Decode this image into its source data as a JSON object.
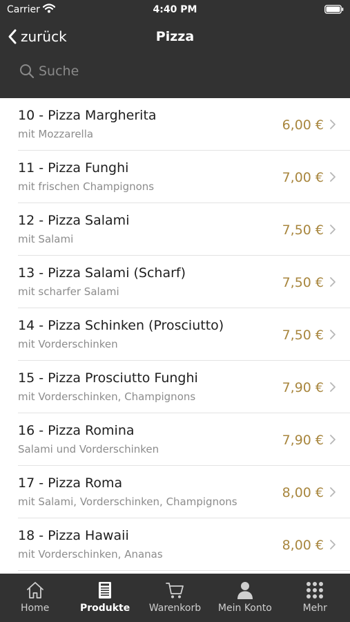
{
  "status_bar": {
    "carrier": "Carrier",
    "time": "4:40 PM"
  },
  "nav": {
    "back_label": "zurück",
    "title": "Pizza"
  },
  "search": {
    "placeholder": "Suche"
  },
  "colors": {
    "header_bg": "#323232",
    "price": "#a8863e",
    "subtitle": "#8c8c8c"
  },
  "products": [
    {
      "title": "10 - Pizza Margherita",
      "subtitle": "mit Mozzarella",
      "price": "6,00 €"
    },
    {
      "title": "11 - Pizza Funghi",
      "subtitle": "mit frischen Champignons",
      "price": "7,00 €"
    },
    {
      "title": "12 - Pizza Salami",
      "subtitle": "mit Salami",
      "price": "7,50 €"
    },
    {
      "title": "13 - Pizza Salami (Scharf)",
      "subtitle": "mit scharfer Salami",
      "price": "7,50 €"
    },
    {
      "title": "14 - Pizza Schinken (Prosciutto)",
      "subtitle": "mit Vorderschinken",
      "price": "7,50 €"
    },
    {
      "title": "15 - Pizza Prosciutto Funghi",
      "subtitle": "mit Vorderschinken, Champignons",
      "price": "7,90 €"
    },
    {
      "title": "16 - Pizza Romina",
      "subtitle": "Salami und Vorderschinken",
      "price": "7,90 €"
    },
    {
      "title": "17 - Pizza Roma",
      "subtitle": "mit Salami, Vorderschinken, Champignons",
      "price": "8,00 €"
    },
    {
      "title": "18 - Pizza Hawaii",
      "subtitle": "mit Vorderschinken, Ananas",
      "price": "8,00 €"
    }
  ],
  "tabbar": {
    "active": "Produkte",
    "tabs": [
      {
        "label": "Home",
        "icon": "home-icon"
      },
      {
        "label": "Produkte",
        "icon": "menu-card-icon"
      },
      {
        "label": "Warenkorb",
        "icon": "cart-icon"
      },
      {
        "label": "Mein Konto",
        "icon": "person-icon"
      },
      {
        "label": "Mehr",
        "icon": "grid-icon"
      }
    ]
  }
}
